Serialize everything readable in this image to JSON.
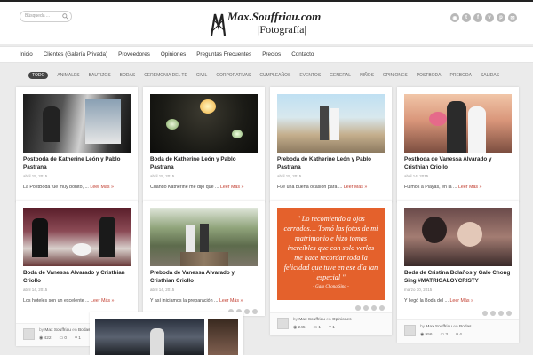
{
  "header": {
    "search_placeholder": "Búsqueda ...",
    "logo_line1": "Max.Souffriau.com",
    "logo_line2": "|Fotografía|",
    "social_icons": [
      "rss-icon",
      "twitter-icon",
      "facebook-icon",
      "vimeo-icon",
      "pinterest-icon",
      "email-icon"
    ]
  },
  "nav": {
    "items": [
      "Inicio",
      "Clientes (Galería Privada)",
      "Proveedores",
      "Opiniones",
      "Preguntas Frecuentes",
      "Precios",
      "Contacto"
    ]
  },
  "filters": [
    "TODO",
    "ANIMALES",
    "BAUTIZOS",
    "BODAS",
    "CEREMONIA DEL TE",
    "CIVIL",
    "CORPORATIVAS",
    "CUMPLEAÑOS",
    "EVENTOS",
    "GENERAL",
    "NIÑOS",
    "OPINIONES",
    "POSTBODA",
    "PREBODA",
    "SALIDAS"
  ],
  "cards": [
    {
      "title": "Postboda de Katherine León y Pablo Pastrana",
      "date": "abril 15, 2015",
      "excerpt": "La PostBoda fue muy bonito, ...",
      "more": "Leer Más »"
    },
    {
      "title": "Boda de Katherine León y Pablo Pastrana",
      "date": "abril 15, 2015",
      "excerpt": "Cuando Katherine me dijo que ...",
      "more": "Leer Más »"
    },
    {
      "title": "Preboda de Katherine León y Pablo Pastrana",
      "date": "abril 15, 2015",
      "excerpt": "Fue una buena ocasión para ...",
      "more": "Leer Más »"
    },
    {
      "title": "Postboda de Vanessa Alvarado y Cristhian Criollo",
      "date": "abril 14, 2015",
      "excerpt": "Fuimos a Playas, en la ...",
      "more": "Leer Más »"
    },
    {
      "title": "Boda de Vanessa Alvarado y Cristhian Criollo",
      "date": "abril 14, 2015",
      "excerpt": "Los hoteles son un excelente ...",
      "more": "Leer Más »"
    },
    {
      "title": "Preboda de Vanessa Alvarado y Cristhian Criollo",
      "date": "abril 14, 2015",
      "excerpt": "Y así iniciamos la preparación ...",
      "more": "Leer Más »"
    },
    {
      "title": "Boda de Cristina Bolaños y Galo Chong Sing #MATRIGALOYCRISTY",
      "date": "marzo 30, 2015",
      "excerpt": "Y llegó la Boda del ...",
      "more": "Leer Más »"
    }
  ],
  "quote": {
    "text": "\" Lo recomiendo a ojos cerrados… Tomó las fotos de mi matrimonio e hizo tomas increíbles que con solo verlas me hace recordar toda la felicidad que tuve en ese día tan especial \"",
    "author": "- Galo Chong Sing -"
  },
  "footers": {
    "col1": {
      "by": "by",
      "author": "Max Souffriau",
      "in": "en",
      "category": "Bodas",
      "views": "422",
      "comments": "0",
      "likes": "1"
    },
    "col3": {
      "by": "by",
      "author": "Max Souffriau",
      "in": "en",
      "category": "Opiniones",
      "views": "245",
      "comments": "1",
      "likes": "1"
    },
    "col4": {
      "by": "by",
      "author": "Max Souffriau",
      "in": "en",
      "category": "Bodas",
      "views": "956",
      "comments": "3",
      "likes": "4"
    }
  },
  "colors": {
    "accent": "#c0392b",
    "quote_bg": "#e4612c",
    "page_bg": "#ebebeb"
  }
}
